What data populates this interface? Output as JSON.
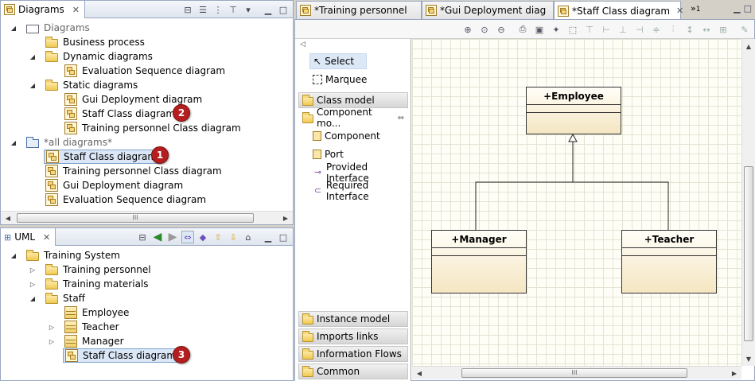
{
  "diagrams_view": {
    "title": "Diagrams",
    "tree": [
      {
        "label": "Diagrams"
      },
      {
        "label": "Business process"
      },
      {
        "label": "Dynamic diagrams"
      },
      {
        "label": "Evaluation Sequence diagram"
      },
      {
        "label": "Static diagrams"
      },
      {
        "label": "Gui Deployment diagram"
      },
      {
        "label": "Staff Class diagram"
      },
      {
        "label": "Training personnel Class diagram"
      },
      {
        "label": "*all diagrams*"
      },
      {
        "label": "Staff Class diagram"
      },
      {
        "label": "Training personnel Class diagram"
      },
      {
        "label": "Gui Deployment diagram"
      },
      {
        "label": "Evaluation Sequence diagram"
      }
    ]
  },
  "uml_view": {
    "title": "UML",
    "tree": [
      {
        "label": "Training System"
      },
      {
        "label": "Training personnel"
      },
      {
        "label": "Training materials"
      },
      {
        "label": "Staff"
      },
      {
        "label": "Employee"
      },
      {
        "label": "Teacher"
      },
      {
        "label": "Manager"
      },
      {
        "label": "Staff Class diagram"
      }
    ]
  },
  "badges": [
    "1",
    "2",
    "3"
  ],
  "editor_tabs": [
    {
      "label": "*Training personnel"
    },
    {
      "label": "*Gui Deployment diag"
    },
    {
      "label": "*Staff Class diagram"
    },
    {
      "label": "1"
    }
  ],
  "palette": {
    "tools": [
      {
        "label": "Select"
      },
      {
        "label": "Marquee"
      }
    ],
    "drawers_top": [
      {
        "label": "Class model"
      },
      {
        "label": "Component mo..."
      }
    ],
    "component_items": [
      {
        "label": "Component"
      },
      {
        "label": "Port"
      },
      {
        "label": "Provided Interface"
      },
      {
        "label": "Required Interface"
      }
    ],
    "drawers_bottom": [
      {
        "label": "Instance model"
      },
      {
        "label": "Imports links"
      },
      {
        "label": "Information Flows"
      },
      {
        "label": "Common"
      }
    ]
  },
  "diagram": {
    "classes": [
      {
        "name": "+Employee"
      },
      {
        "name": "+Manager"
      },
      {
        "name": "+Teacher"
      }
    ]
  },
  "colors": {
    "badge": "#b41e1e",
    "selection": "#dbe7f7",
    "canvas": "#fffef6"
  },
  "scrollbar_symbol": "III"
}
